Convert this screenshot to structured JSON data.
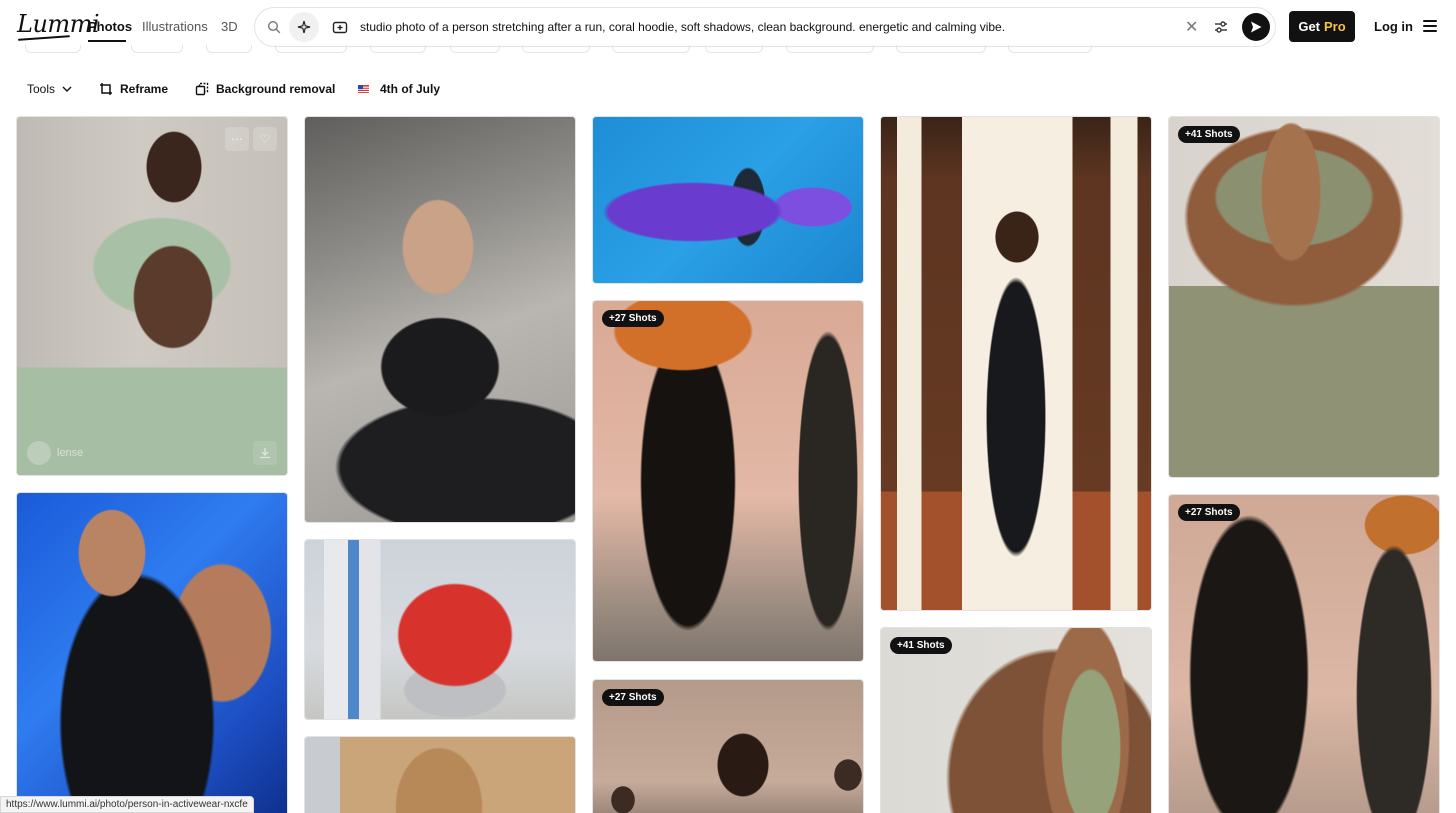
{
  "app": {
    "logo_text": "Lummi"
  },
  "nav": {
    "tabs": [
      {
        "label": "Photos",
        "active": true
      },
      {
        "label": "Illustrations",
        "active": false
      },
      {
        "label": "3D",
        "active": false
      }
    ]
  },
  "search": {
    "query": "studio photo of a person stretching after a run, coral hoodie, soft shadows, clean background. energetic and calming vibe.",
    "icons": [
      "search-icon",
      "ai-sparkle-icon",
      "image-search-icon",
      "clear-icon",
      "filter-icon",
      "send-icon"
    ]
  },
  "header_actions": {
    "get_label": "Get",
    "pro_label": "Pro",
    "login_label": "Log in",
    "accent_color": "#f6c343"
  },
  "toolbar": {
    "tools_label": "Tools",
    "reframe_label": "Reframe",
    "background_removal_label": "Background removal",
    "holiday_label": "4th of July",
    "holiday_icon": "us-flag-icon"
  },
  "gallery": {
    "cards": [
      {
        "name": "photo-sage-crop-top-woman",
        "badge": "",
        "author": "lense"
      },
      {
        "name": "photo-black-sports-bra-shadows",
        "badge": ""
      },
      {
        "name": "photo-runner-purple-shards",
        "badge": ""
      },
      {
        "name": "photo-window-stretch-silhouette",
        "badge": ""
      },
      {
        "name": "photo-olive-set-prayer-hands",
        "badge": "+41 Shots"
      },
      {
        "name": "photo-blue-tank-runner-man",
        "badge": ""
      },
      {
        "name": "photo-red-hoodie-lunge",
        "badge": ""
      },
      {
        "name": "photo-running-legs-orange",
        "badge": "+27 Shots"
      },
      {
        "name": "photo-prayer-hands-closeup",
        "badge": "+41 Shots"
      },
      {
        "name": "photo-running-legs-closeup",
        "badge": "+27 Shots"
      },
      {
        "name": "photo-woman-wood-background",
        "badge": ""
      },
      {
        "name": "photo-group-runners-back",
        "badge": "+27 Shots"
      }
    ]
  },
  "status": {
    "url": "https://www.lummi.ai/photo/person-in-activewear-nxcfe"
  }
}
